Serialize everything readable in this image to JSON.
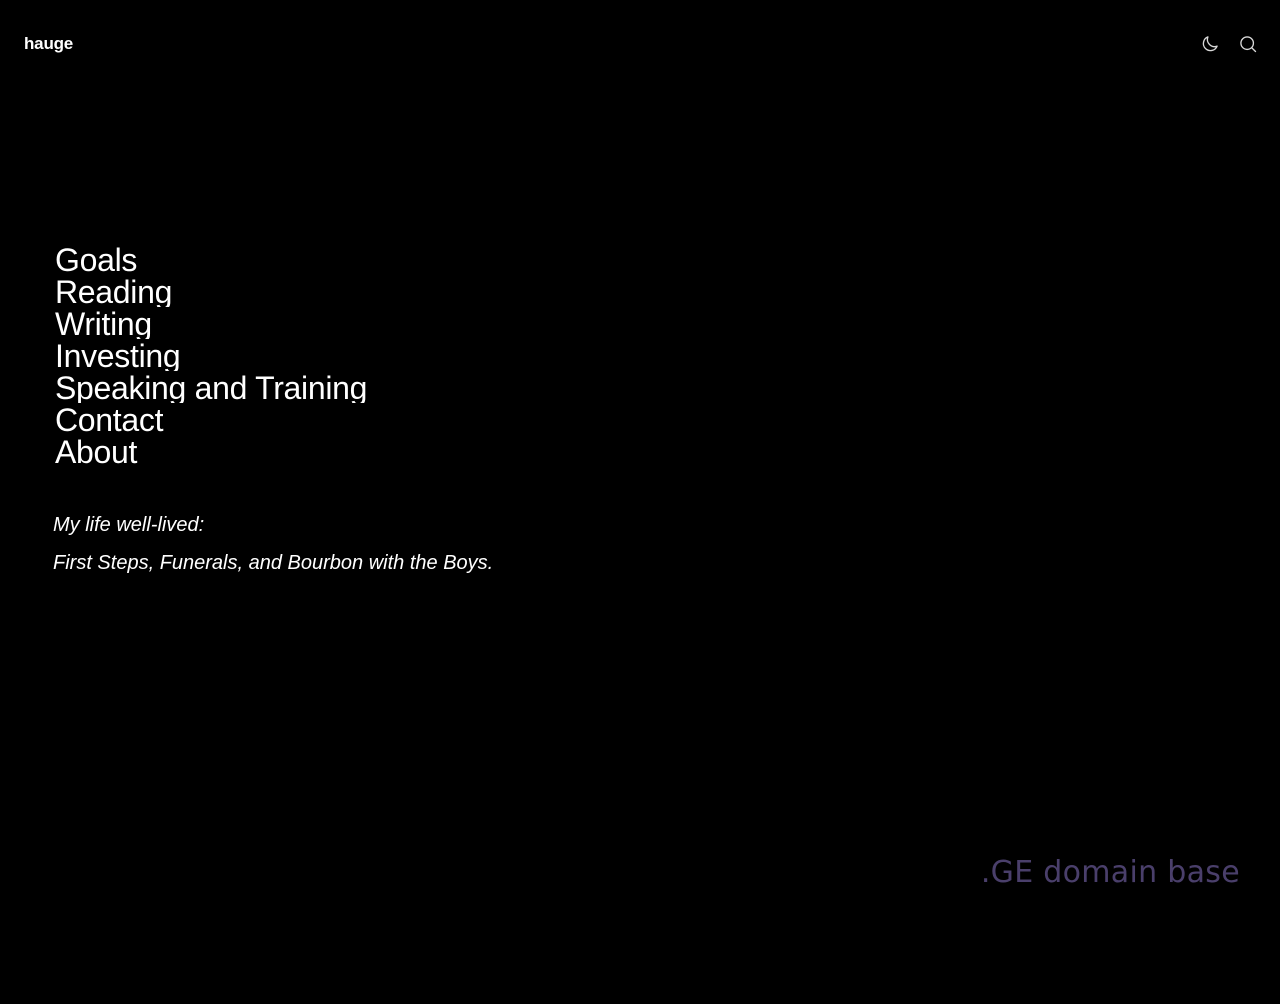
{
  "header": {
    "site_title": "hauge",
    "icons": {
      "theme": "moon-icon",
      "search": "search-icon"
    }
  },
  "nav": {
    "items": [
      {
        "label": "Goals"
      },
      {
        "label": "Reading"
      },
      {
        "label": "Writing"
      },
      {
        "label": "Investing"
      },
      {
        "label": "Speaking and Training"
      },
      {
        "label": "Contact"
      },
      {
        "label": "About"
      }
    ]
  },
  "tagline": {
    "line1": "My life well-lived:",
    "line2": "First Steps, Funerals, and Bourbon with the Boys."
  },
  "watermark": {
    "text": ".GE domain base"
  },
  "colors": {
    "background": "#000000",
    "text": "#ffffff",
    "icon": "#d9d9d9",
    "watermark": "#4a3f6b"
  }
}
